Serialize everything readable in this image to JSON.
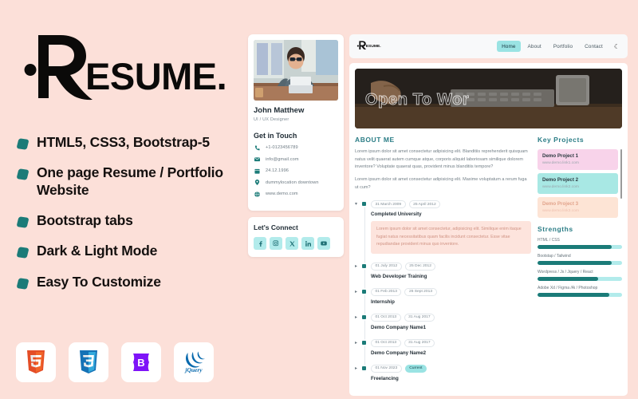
{
  "promo": {
    "logo_text": "RESUME.",
    "features": [
      {
        "label": "HTML5, CSS3, Bootstrap-5"
      },
      {
        "label": "One page Resume / Portfolio Website"
      },
      {
        "label": "Bootstrap tabs"
      },
      {
        "label": "Dark & Light Mode"
      },
      {
        "label": "Easy To Customize"
      }
    ],
    "tech_badges": [
      {
        "name": "html5-icon",
        "label": "HTML5"
      },
      {
        "name": "css3-icon",
        "label": "CSS3"
      },
      {
        "name": "bootstrap-icon",
        "label": "Bootstrap"
      },
      {
        "name": "jquery-icon",
        "label": "jQuery"
      }
    ],
    "colors": {
      "background": "#fce0d9",
      "bullet": "#1b7b78",
      "text": "#14100f"
    }
  },
  "preview": {
    "profile": {
      "name": "John Matthew",
      "role": "UI / UX Designer",
      "get_in_touch_heading": "Get in Touch",
      "contacts": [
        {
          "icon": "phone-icon",
          "value": "+1-0123456789"
        },
        {
          "icon": "email-icon",
          "value": "info@gmail.com"
        },
        {
          "icon": "calendar-icon",
          "value": "24.12.1996"
        },
        {
          "icon": "location-icon",
          "value": "dummylocation downtown"
        },
        {
          "icon": "globe-icon",
          "value": "www.demo.com"
        }
      ],
      "connect_heading": "Let's Connect",
      "socials": [
        {
          "icon": "facebook-icon",
          "label": "f"
        },
        {
          "icon": "instagram-icon",
          "label": ""
        },
        {
          "icon": "twitter-x-icon",
          "label": "X"
        },
        {
          "icon": "linkedin-icon",
          "label": "in"
        },
        {
          "icon": "youtube-icon",
          "label": ""
        }
      ]
    },
    "navbar": {
      "logo_text": "RESUME.",
      "links": [
        {
          "label": "Home",
          "active": true
        },
        {
          "label": "About",
          "active": false
        },
        {
          "label": "Portfolio",
          "active": false
        },
        {
          "label": "Contact",
          "active": false
        }
      ],
      "theme_toggle_icon": "moon-icon",
      "theme_toggle_glyph": "☾"
    },
    "hero": {
      "title": "Open To Wor"
    },
    "about": {
      "heading": "ABOUT ME",
      "paragraphs": [
        "Lorem ipsum dolor sit amet consectetur adipisicing elit. Blanditiis reprehenderit quisquam natus velit quaerat autem cumque atque, corporis aliquid laboriosam similique dolorem inventore? Voluptate quaerat quas, provident minus blanditiis tempore?",
        "Lorem ipsum dolor sit amet consectetur adipisicing elit. Maxime voluptatum a rerum fuga ut cum?"
      ],
      "timeline": [
        {
          "start": "31 March 2009",
          "end": "25 April 2012",
          "role": "Completed University",
          "expanded": true,
          "description": "Lorem ipsum dolor sit amet consectetur, adipisicing elit. Similique enim itaque fugiat natus necessitatibus quam facilis incidunt consectetur. Esse vitae repudiandae provident minus quo inventore."
        },
        {
          "start": "01 July 2012",
          "end": "25 Dec 2012",
          "role": "Web Developer Training",
          "expanded": false
        },
        {
          "start": "01 Feb 2013",
          "end": "26 Sept 2013",
          "role": "Internship",
          "expanded": false
        },
        {
          "start": "01 Oct 2013",
          "end": "31 Aug 2017",
          "role": "Demo Company Name1",
          "expanded": false
        },
        {
          "start": "01 Oct 2013",
          "end": "31 Aug 2017",
          "role": "Demo Company Name2",
          "expanded": false
        },
        {
          "start": "01 Nov 2023",
          "end": "Current",
          "role": "Freelancing",
          "expanded": false,
          "end_is_badge": true
        }
      ]
    },
    "key_projects": {
      "heading": "Key Projects",
      "items": [
        {
          "name": "Demo Project 1",
          "link": "www.demo.link1.com",
          "color": "#f8d3ea"
        },
        {
          "name": "Demo Project 2",
          "link": "www.demo.link2.com",
          "color": "#a8e8e4"
        },
        {
          "name": "Demo Project 3",
          "link": "www.demo.link3.com",
          "color": "#fde4d5"
        }
      ]
    },
    "strengths": {
      "heading": "Strengths",
      "skills": [
        {
          "label": "HTML / CSS",
          "value": 88
        },
        {
          "label": "Bootstap / Tailwind",
          "value": 88
        },
        {
          "label": "Wordpress / Js / Jquery / React",
          "value": 72
        },
        {
          "label": "Adobe Xd / Figma /Ai / Photoshop",
          "value": 85
        }
      ]
    }
  }
}
